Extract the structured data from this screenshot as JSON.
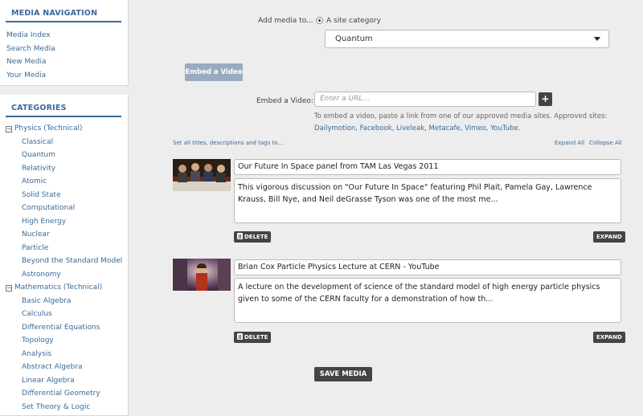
{
  "sidebar": {
    "nav": {
      "title": "MEDIA NAVIGATION",
      "items": [
        "Media Index",
        "Search Media",
        "New Media",
        "Your Media"
      ]
    },
    "categories": {
      "title": "CATEGORIES",
      "groups": [
        {
          "label": "Physics (Technical)",
          "toggle": "−",
          "items": [
            "Classical",
            "Quantum",
            "Relativity",
            "Atomic",
            "Solid State",
            "Computational",
            "High Energy",
            "Nuclear",
            "Particle",
            "Beyond the Standard Model",
            "Astronomy"
          ]
        },
        {
          "label": "Mathematics (Technical)",
          "toggle": "−",
          "items": [
            "Basic Algebra",
            "Calculus",
            "Differential Equations",
            "Topology",
            "Analysis",
            "Abstract Algebra",
            "Linear Algebra",
            "Differential Geometry",
            "Set Theory & Logic"
          ]
        }
      ]
    }
  },
  "form": {
    "add_media_label": "Add media to...",
    "radio_label": "A site category",
    "category_value": "Quantum",
    "embed_button": "Embed a Video",
    "embed_label": "Embed a Video:",
    "url_placeholder": "Enter a URL...",
    "plus_label": "+",
    "help_text": "To embed a video, paste a link from one of our approved media sites. Approved sites:",
    "approved_sites": "Dailymotion, Facebook, Liveleak, Metacafe, Vimeo, YouTube.",
    "set_all_link": "Set all titles, descriptions and tags to...",
    "expand_all": "Expand All",
    "collapse_all": "Collapse All",
    "save_button": "SAVE MEDIA"
  },
  "media_items": [
    {
      "title": "Our Future In Space panel from TAM Las Vegas 2011",
      "description": "This vigorous discussion on \"Our Future In Space\" featuring Phil Plait, Pamela Gay, Lawrence Krauss, Bill Nye, and Neil deGrasse Tyson was one of the most me...",
      "delete_label": "DELETE",
      "expand_label": "EXPAND"
    },
    {
      "title": "Brian Cox Particle Physics Lecture at CERN - YouTube",
      "description": "A lecture on the development of science of the standard model of high energy particle physics given to some of the CERN faculty for a demonstration of how th...",
      "delete_label": "DELETE",
      "expand_label": "EXPAND"
    }
  ]
}
